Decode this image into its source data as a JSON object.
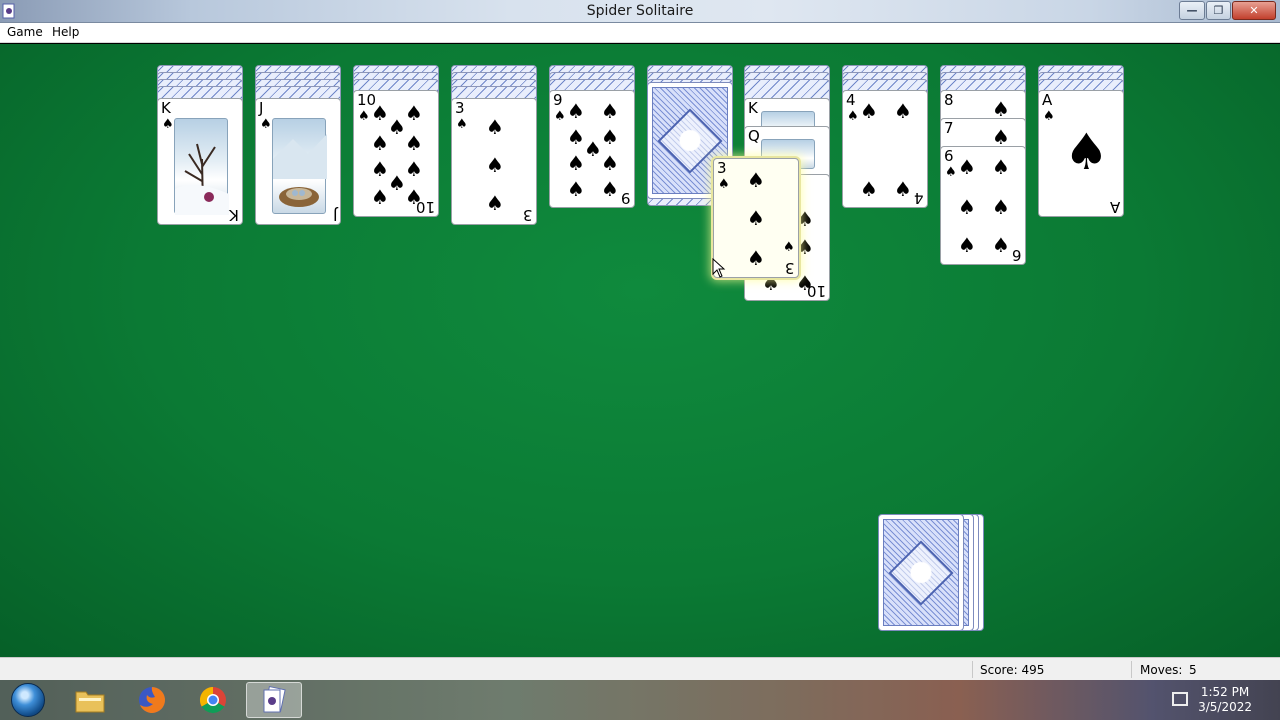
{
  "window": {
    "title": "Spider Solitaire",
    "buttons": {
      "minimize": "—",
      "maximize": "❐",
      "close": "✕"
    }
  },
  "menu": {
    "items": [
      "Game",
      "Help"
    ]
  },
  "tableau": {
    "columns": [
      {
        "face_up": [
          {
            "rank": "K",
            "suit": "♠",
            "art": "winter-tree"
          }
        ]
      },
      {
        "face_up": [
          {
            "rank": "J",
            "suit": "♠",
            "art": "bird-nest"
          }
        ]
      },
      {
        "face_up": [
          {
            "rank": "10",
            "suit": "♠"
          }
        ]
      },
      {
        "face_up": [
          {
            "rank": "3",
            "suit": "♠"
          }
        ]
      },
      {
        "face_up": [
          {
            "rank": "9",
            "suit": "♠"
          }
        ]
      },
      {
        "face_up": []
      },
      {
        "face_up": [
          {
            "rank": "K",
            "suit": "♠"
          },
          {
            "rank": "Q",
            "suit": "♠"
          },
          {
            "rank": "10",
            "suit": "♠"
          }
        ]
      },
      {
        "face_up": [
          {
            "rank": "4",
            "suit": "♠"
          }
        ]
      },
      {
        "face_up": [
          {
            "rank": "8",
            "suit": "♠"
          },
          {
            "rank": "7",
            "suit": "♠"
          },
          {
            "rank": "6",
            "suit": "♠"
          }
        ]
      },
      {
        "face_up": [
          {
            "rank": "A",
            "suit": "♠"
          }
        ]
      }
    ]
  },
  "dragged_card": {
    "rank": "3",
    "suit": "♠"
  },
  "status": {
    "score_label": "Score: 495",
    "moves_label": "Moves:",
    "moves_value": "5"
  },
  "taskbar": {
    "apps": [
      "start-orb",
      "file-explorer",
      "firefox",
      "chrome",
      "spider-solitaire"
    ],
    "time": "1:52 PM",
    "date": "3/5/2022"
  },
  "colors": {
    "felt": "#0b7a34",
    "card_back_blue": "#4b62b0"
  }
}
